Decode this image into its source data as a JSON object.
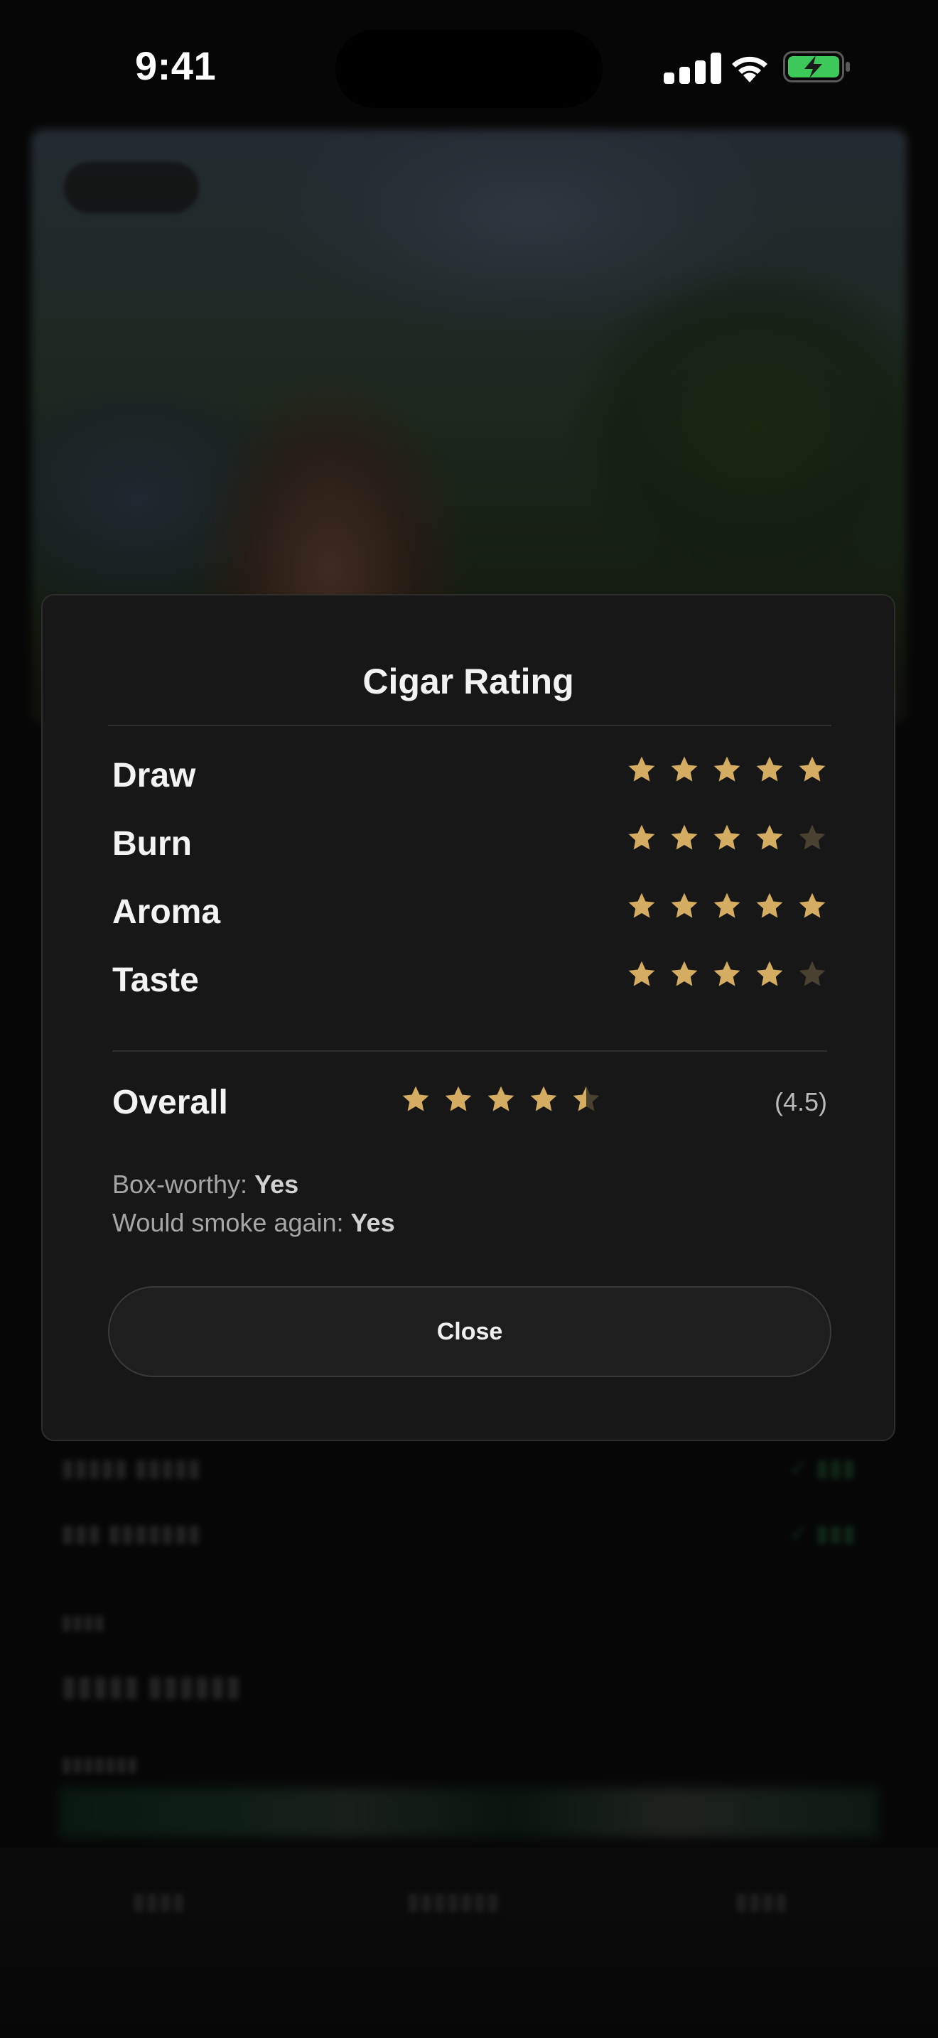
{
  "status_bar": {
    "time": "9:41"
  },
  "modal": {
    "title": "Cigar Rating",
    "ratings": [
      {
        "label": "Draw",
        "stars": 5
      },
      {
        "label": "Burn",
        "stars": 4
      },
      {
        "label": "Aroma",
        "stars": 5
      },
      {
        "label": "Taste",
        "stars": 4
      }
    ],
    "overall": {
      "label": "Overall",
      "stars": 4.5,
      "value_text": "(4.5)"
    },
    "box_worthy": {
      "label": "Box-worthy:",
      "value": "Yes"
    },
    "smoke_again": {
      "label": "Would smoke again:",
      "value": "Yes"
    },
    "close_label": "Close"
  },
  "colors": {
    "star_filled": "#d4ac62",
    "star_empty": "#4a4231",
    "accent_green": "#3cc95a"
  },
  "icons": [
    "signal-icon",
    "wifi-icon",
    "battery-charging-icon",
    "star-icon"
  ]
}
